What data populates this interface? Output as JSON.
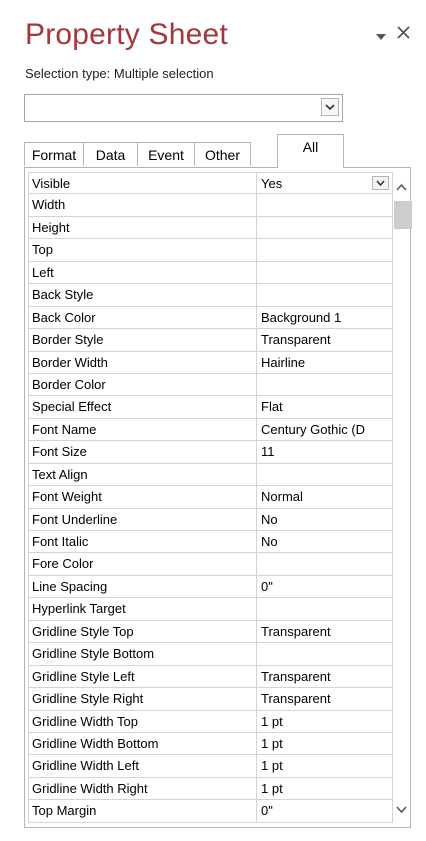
{
  "panel": {
    "title": "Property Sheet",
    "selection_type_label": "Selection type:  Multiple selection",
    "selector_value": ""
  },
  "tabs": [
    {
      "label": "Format"
    },
    {
      "label": "Data"
    },
    {
      "label": "Event"
    },
    {
      "label": "Other"
    },
    {
      "label": "All"
    }
  ],
  "active_tab": "All",
  "properties": [
    {
      "name": "Visible",
      "value": "Yes"
    },
    {
      "name": "Width",
      "value": ""
    },
    {
      "name": "Height",
      "value": ""
    },
    {
      "name": "Top",
      "value": ""
    },
    {
      "name": "Left",
      "value": ""
    },
    {
      "name": "Back Style",
      "value": ""
    },
    {
      "name": "Back Color",
      "value": "Background 1"
    },
    {
      "name": "Border Style",
      "value": "Transparent"
    },
    {
      "name": "Border Width",
      "value": "Hairline"
    },
    {
      "name": "Border Color",
      "value": ""
    },
    {
      "name": "Special Effect",
      "value": "Flat"
    },
    {
      "name": "Font Name",
      "value": "Century Gothic (D"
    },
    {
      "name": "Font Size",
      "value": "11"
    },
    {
      "name": "Text Align",
      "value": ""
    },
    {
      "name": "Font Weight",
      "value": "Normal"
    },
    {
      "name": "Font Underline",
      "value": "No"
    },
    {
      "name": "Font Italic",
      "value": "No"
    },
    {
      "name": "Fore Color",
      "value": ""
    },
    {
      "name": "Line Spacing",
      "value": "0\""
    },
    {
      "name": "Hyperlink Target",
      "value": ""
    },
    {
      "name": "Gridline Style Top",
      "value": "Transparent"
    },
    {
      "name": "Gridline Style Bottom",
      "value": ""
    },
    {
      "name": "Gridline Style Left",
      "value": "Transparent"
    },
    {
      "name": "Gridline Style Right",
      "value": "Transparent"
    },
    {
      "name": "Gridline Width Top",
      "value": "1 pt"
    },
    {
      "name": "Gridline Width Bottom",
      "value": "1 pt"
    },
    {
      "name": "Gridline Width Left",
      "value": "1 pt"
    },
    {
      "name": "Gridline Width Right",
      "value": "1 pt"
    },
    {
      "name": "Top Margin",
      "value": "0\""
    }
  ],
  "colors": {
    "title": "#a4373a",
    "border": "#b5b5b5",
    "grid_line": "#d4d4d4",
    "scroll_thumb": "#cdcdcd"
  },
  "icons": {
    "pane_menu": "chevron-down-icon",
    "pane_close": "close-icon",
    "selector_dropdown": "chevron-down-icon",
    "row_dropdown": "chevron-down-icon",
    "scroll_up": "chevron-up-icon",
    "scroll_down": "chevron-down-icon"
  }
}
